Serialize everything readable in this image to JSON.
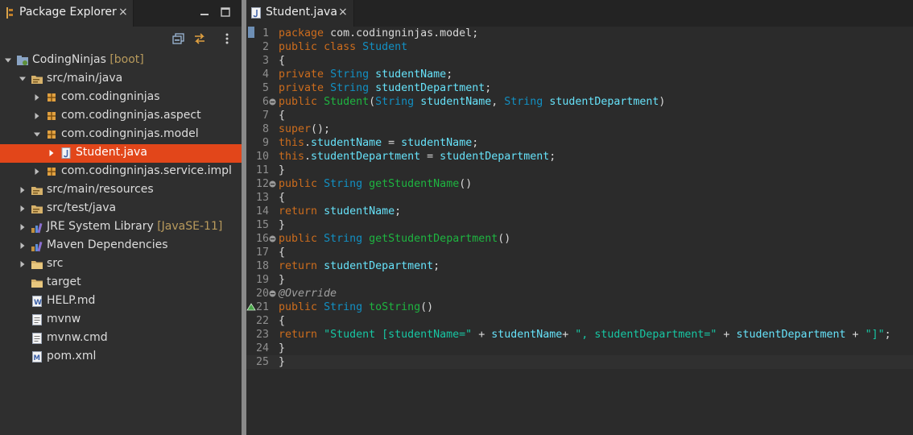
{
  "package_explorer": {
    "tab_title": "Package Explorer",
    "tab_close": "×",
    "tree": [
      {
        "label": "CodingNinjas",
        "suffix": "[boot]",
        "icon": "project-icon",
        "expanded": true
      },
      {
        "label": "src/main/java",
        "suffix": "",
        "icon": "source-folder-icon",
        "expanded": true
      },
      {
        "label": "com.codingninjas",
        "suffix": "",
        "icon": "package-icon",
        "expanded": false
      },
      {
        "label": "com.codingninjas.aspect",
        "suffix": "",
        "icon": "package-icon",
        "expanded": false
      },
      {
        "label": "com.codingninjas.model",
        "suffix": "",
        "icon": "package-icon",
        "expanded": true
      },
      {
        "label": "Student.java",
        "suffix": "",
        "icon": "java-file-icon",
        "expanded": false,
        "selected": true
      },
      {
        "label": "com.codingninjas.service.impl",
        "suffix": "",
        "icon": "package-icon",
        "expanded": false
      },
      {
        "label": "src/main/resources",
        "suffix": "",
        "icon": "source-folder-icon",
        "expanded": false
      },
      {
        "label": "src/test/java",
        "suffix": "",
        "icon": "source-folder-icon",
        "expanded": false
      },
      {
        "label": "JRE System Library",
        "suffix": "[JavaSE-11]",
        "icon": "library-icon",
        "expanded": false
      },
      {
        "label": "Maven Dependencies",
        "suffix": "",
        "icon": "library-icon",
        "expanded": false
      },
      {
        "label": "src",
        "suffix": "",
        "icon": "folder-icon",
        "expanded": false
      },
      {
        "label": "target",
        "suffix": "",
        "icon": "folder-icon",
        "expanded": false
      },
      {
        "label": "HELP.md",
        "suffix": "",
        "icon": "markdown-file-icon",
        "expanded": false
      },
      {
        "label": "mvnw",
        "suffix": "",
        "icon": "text-file-icon",
        "expanded": false
      },
      {
        "label": "mvnw.cmd",
        "suffix": "",
        "icon": "text-file-icon",
        "expanded": false
      },
      {
        "label": "pom.xml",
        "suffix": "",
        "icon": "maven-file-icon",
        "expanded": false
      }
    ]
  },
  "editor": {
    "tab_title": "Student.java",
    "tab_close": "×",
    "lines": [
      {
        "n": "1",
        "t": "package com.codingninjas.model;"
      },
      {
        "n": "2",
        "t": "public class Student"
      },
      {
        "n": "3",
        "t": "{"
      },
      {
        "n": "4",
        "t": "private String studentName;"
      },
      {
        "n": "5",
        "t": "private String studentDepartment;"
      },
      {
        "n": "6",
        "t": "public Student(String studentName, String studentDepartment)"
      },
      {
        "n": "7",
        "t": "{"
      },
      {
        "n": "8",
        "t": "super();"
      },
      {
        "n": "9",
        "t": "this.studentName = studentName;"
      },
      {
        "n": "10",
        "t": "this.studentDepartment = studentDepartment;"
      },
      {
        "n": "11",
        "t": "}"
      },
      {
        "n": "12",
        "t": "public String getStudentName()"
      },
      {
        "n": "13",
        "t": "{"
      },
      {
        "n": "14",
        "t": "return studentName;"
      },
      {
        "n": "15",
        "t": "}"
      },
      {
        "n": "16",
        "t": "public String getStudentDepartment()"
      },
      {
        "n": "17",
        "t": "{"
      },
      {
        "n": "18",
        "t": "return studentDepartment;"
      },
      {
        "n": "19",
        "t": "}"
      },
      {
        "n": "20",
        "t": "@Override"
      },
      {
        "n": "21",
        "t": "public String toString()"
      },
      {
        "n": "22",
        "t": "{"
      },
      {
        "n": "23",
        "t": "return \"Student [studentName=\" + studentName+ \", studentDepartment=\" + studentDepartment + \"]\";"
      },
      {
        "n": "24",
        "t": "}"
      },
      {
        "n": "25",
        "t": "}"
      }
    ]
  },
  "colors": {
    "selection": "#e2461a",
    "keyword": "#cc6c1d",
    "type": "#1290c3",
    "field": "#66e1f8",
    "method": "#1eb540",
    "string": "#17c6a3"
  }
}
